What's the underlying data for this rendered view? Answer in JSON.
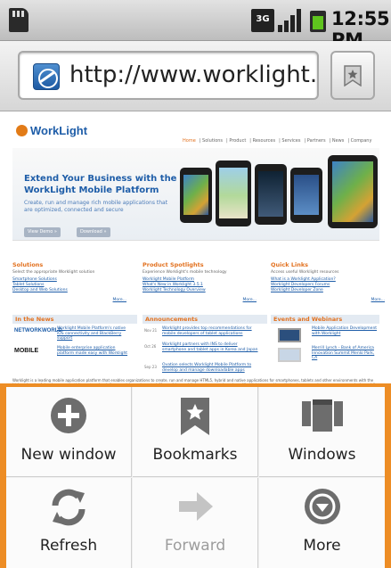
{
  "status_bar": {
    "time": "12:55 PM",
    "network": "3G",
    "icons": [
      "sd-card-icon",
      "3g-icon",
      "signal-icon",
      "battery-icon"
    ]
  },
  "browser": {
    "url": "http://www.worklight....",
    "bookmark_icon": "star-bookmark-icon"
  },
  "webpage": {
    "logo": "WorkLight",
    "nav": [
      "Home",
      "Solutions",
      "Product",
      "Resources",
      "Services",
      "Partners",
      "News",
      "Company"
    ],
    "hero_title": "Extend Your Business with the WorkLight Mobile Platform",
    "hero_sub": "Create, run and manage rich mobile applications that are optimized, connected and secure",
    "hero_btn1": "View Demo »",
    "hero_btn2": "Download »",
    "col1": {
      "title": "Solutions",
      "desc": "Select the appropriate Worklight solution",
      "links": [
        "Smartphone Solutions",
        "Tablet Solutions",
        "Desktop and Web Solutions"
      ],
      "more": "More..."
    },
    "col2": {
      "title": "Product Spotlights",
      "desc": "Experience Worklight's mobile technology",
      "links": [
        "Worklight Mobile Platform",
        "What's New in Worklight 3.5.1",
        "Worklight Technology Overview"
      ],
      "more": "More..."
    },
    "col3": {
      "title": "Quick Links",
      "desc": "Access useful Worklight resources",
      "links": [
        "What is a Worklight Application?",
        "Worklight Developers Forums",
        "Worklight Developer Zone"
      ],
      "more": "More..."
    },
    "news": {
      "title": "In the News",
      "items": [
        {
          "logo": "NETWORKWORLD",
          "text": "Worklight Mobile Platform's native iOS connectivity and BlackBerry support"
        },
        {
          "logo": "MOBILE",
          "text": "Mobile enterprise application platform made easy with Worklight"
        }
      ]
    },
    "announcements": {
      "title": "Announcements",
      "items": [
        {
          "date": "Nov 21",
          "text": "Worklight provides top recommendations for mobile developers of tablet applications"
        },
        {
          "date": "Oct 26",
          "text": "Worklight partners with INS to deliver smartphone and tablet apps in Korea and Japan"
        },
        {
          "date": "Sep 23",
          "text": "Ovation selects Worklight Mobile Platform to develop and manage downloadable apps"
        }
      ]
    },
    "events": {
      "title": "Events and Webinars",
      "items": [
        {
          "text": "Mobile Application Development with Worklight"
        },
        {
          "text": "Merrill Lynch - Bank of America Innovation Summit Menlo Park, CA"
        }
      ]
    },
    "footer": "Worklight is a leading mobile application platform that enables organizations to create, run and manage HTML5, hybrid and native applications for smartphones, tablets and other environments with the highest levels of developer productivity, enterprise delivery and dynamic control. Many of the world's largest companies rely on Worklight to provide optimized user experiences across more devices while dramatically reducing time to market, development cost and ongoing maintenance effort."
  },
  "menu": {
    "items": [
      {
        "label": "New window",
        "icon": "plus-icon",
        "enabled": true
      },
      {
        "label": "Bookmarks",
        "icon": "bookmark-star-icon",
        "enabled": true
      },
      {
        "label": "Windows",
        "icon": "windows-icon",
        "enabled": true
      },
      {
        "label": "Refresh",
        "icon": "refresh-icon",
        "enabled": true
      },
      {
        "label": "Forward",
        "icon": "forward-arrow-icon",
        "enabled": false
      },
      {
        "label": "More",
        "icon": "chevron-down-circle-icon",
        "enabled": true
      }
    ]
  },
  "colors": {
    "accent": "#ed8d25",
    "link": "#1e5da8",
    "orange_heading": "#e2711f"
  }
}
